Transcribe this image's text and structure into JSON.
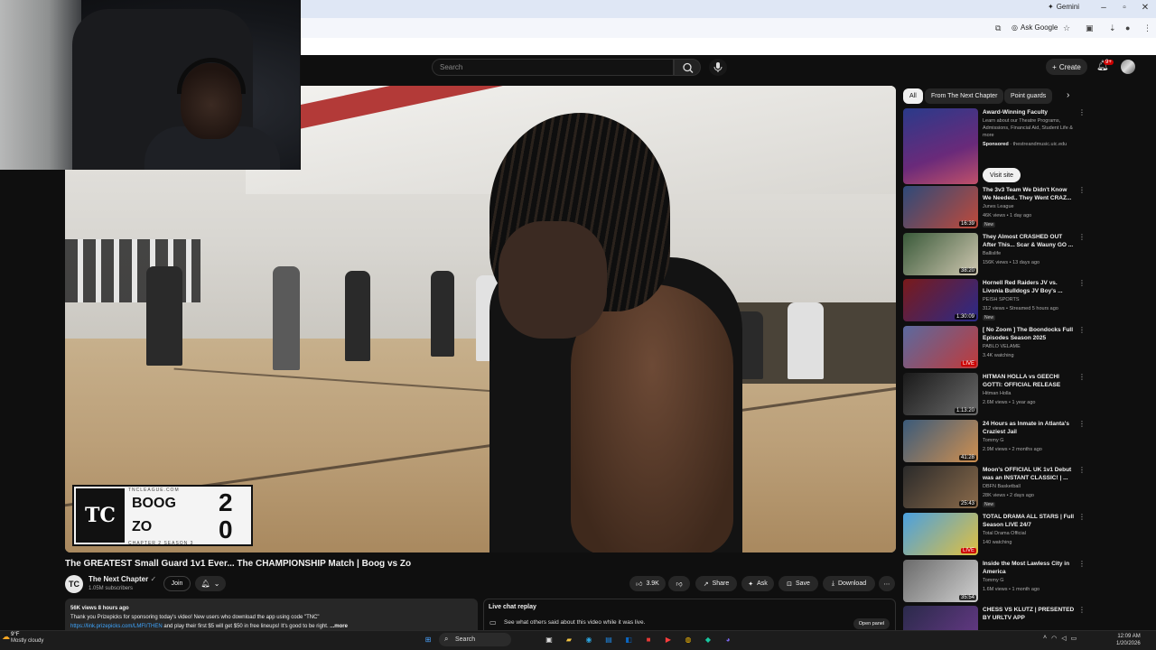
{
  "browser": {
    "gemini_label": "Gemini",
    "ask_google_label": "Ask Google"
  },
  "yt_header": {
    "search_placeholder": "Search",
    "create_label": "Create",
    "notif_count": "9+"
  },
  "video": {
    "scorebug": {
      "site": "TNCLEAGUE.COM",
      "player1": "BOOG",
      "player2": "ZO",
      "score1": "2",
      "score2": "0",
      "season": "CHAPTER 2 SEASON 3"
    },
    "title": "The GREATEST Small Guard 1v1 Ever... The CHAMPIONSHIP Match | Boog vs Zo",
    "channel": {
      "name": "The Next Chapter",
      "subscribers": "1.05M subscribers",
      "join_label": "Join"
    },
    "actions": {
      "likes": "3.9K",
      "share": "Share",
      "ask": "Ask",
      "save": "Save",
      "download": "Download"
    },
    "description": {
      "meta": "56K views  8 hours ago",
      "line1": "Thank you Prizepicks for sponsoring today's video! New users who download the app using code \"TNC\"",
      "link": "https://link.prizepicks.com/LMFI/THEN",
      "line2": "and play their first $5 will get $50 in free lineups! It's good to be right.",
      "more": "...more"
    },
    "live_chat": {
      "title": "Live chat replay",
      "subtitle": "See what others said about this video while it was live.",
      "open_label": "Open panel"
    }
  },
  "sidebar": {
    "chips": [
      "All",
      "From The Next Chapter",
      "Point guards"
    ],
    "ad": {
      "title": "Award-Winning Faculty",
      "desc": "Learn about our Theatre Programs, Admissions, Financial Aid, Student Life & more",
      "sponsor_label": "Sponsored",
      "sponsor_domain": "thestreandmusic.uic.edu",
      "cta": "Visit site"
    },
    "recs": [
      {
        "title": "The 3v3 Team We Didn't Know We Needed.. They Went CRAZ...",
        "channel": "Junes League",
        "meta": "46K views • 1 day ago",
        "badge": "New",
        "duration": "16:39",
        "live": false
      },
      {
        "title": "They Almost CRASHED OUT After This... Scar & Wauny GO ...",
        "channel": "Ballislife",
        "meta": "156K views • 13 days ago",
        "badge": "",
        "duration": "38:20",
        "live": false
      },
      {
        "title": "Hornell Red Raiders JV vs. Livonia Bulldogs JV Boy's ...",
        "channel": "PEISH SPORTS",
        "meta": "312 views • Streamed 5 hours ago",
        "badge": "New",
        "duration": "1:30:09",
        "live": false
      },
      {
        "title": "[ No Zoom ] The Boondocks Full Episodes Season 2025",
        "channel": "PABLO VELAME",
        "meta": "3.4K watching",
        "badge": "",
        "duration": "LIVE",
        "live": true
      },
      {
        "title": "HITMAN HOLLA vs GEECHI GOTTI: OFFICIAL RELEASE",
        "channel": "Hitman Holla",
        "meta": "2.6M views • 1 year ago",
        "badge": "",
        "duration": "1:13:20",
        "live": false
      },
      {
        "title": "24 Hours as Inmate in Atlanta's Craziest Jail",
        "channel": "Tommy G",
        "meta": "2.9M views • 2 months ago",
        "badge": "",
        "duration": "41:28",
        "live": false
      },
      {
        "title": "Moon's OFFICIAL UK 1v1 Debut was an INSTANT CLASSIC! | ...",
        "channel": "DBFN Basketball",
        "meta": "28K views • 2 days ago",
        "badge": "New",
        "duration": "25:43",
        "live": false
      },
      {
        "title": "TOTAL DRAMA ALL STARS | Full Season LIVE 24/7",
        "channel": "Total Drama Official",
        "meta": "140 watching",
        "badge": "",
        "duration": "LIVE",
        "live": true
      },
      {
        "title": "Inside the Most Lawless City in America",
        "channel": "Tommy G",
        "meta": "1.6M views • 1 month ago",
        "badge": "",
        "duration": "35:54",
        "live": false
      },
      {
        "title": "CHESS VS KLUTZ | PRESENTED BY URLTV APP",
        "channel": "",
        "meta": "",
        "badge": "",
        "duration": "",
        "live": false
      }
    ]
  },
  "taskbar": {
    "temp": "9°F",
    "weather": "Mostly cloudy",
    "search_label": "Search",
    "time": "12:09 AM",
    "date": "1/20/2026"
  },
  "colors": {
    "yt_bg": "#0f0f0f",
    "live_red": "#cc0000",
    "link_blue": "#3ea6ff"
  }
}
